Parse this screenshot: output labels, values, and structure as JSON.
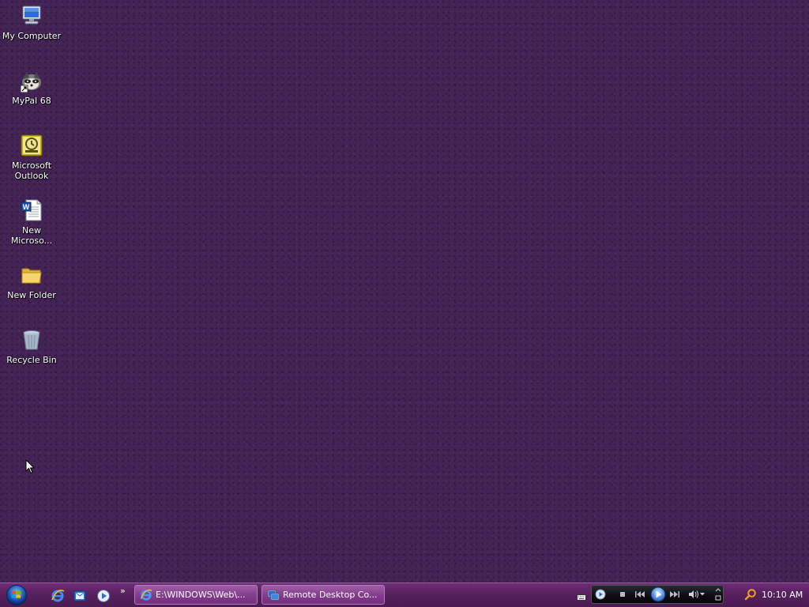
{
  "desktop": {
    "icons": [
      {
        "label_line1": "My Computer",
        "label_line2": ""
      },
      {
        "label_line1": "MyPal 68",
        "label_line2": ""
      },
      {
        "label_line1": "Microsoft",
        "label_line2": "Outlook"
      },
      {
        "label_line1": "New",
        "label_line2": "Microso..."
      },
      {
        "label_line1": "New Folder",
        "label_line2": ""
      },
      {
        "label_line1": "Recycle Bin",
        "label_line2": ""
      }
    ]
  },
  "taskbar": {
    "quick_launch_more": "»",
    "tasks": [
      {
        "label": "E:\\WINDOWS\\Web\\..."
      },
      {
        "label": "Remote Desktop Co..."
      }
    ],
    "clock": "10:10 AM"
  },
  "colors": {
    "desktop_bg": "#432454",
    "taskbar": "#57205e",
    "task_button": "#843f8c"
  },
  "icons": [
    "computer-icon",
    "raccoon-icon",
    "outlook-icon",
    "word-doc-icon",
    "folder-icon",
    "recycle-bin-icon",
    "start-orb-icon",
    "ie-icon",
    "outlook-express-icon",
    "media-player-icon",
    "remote-desktop-icon",
    "keyboard-icon",
    "search-icon"
  ]
}
